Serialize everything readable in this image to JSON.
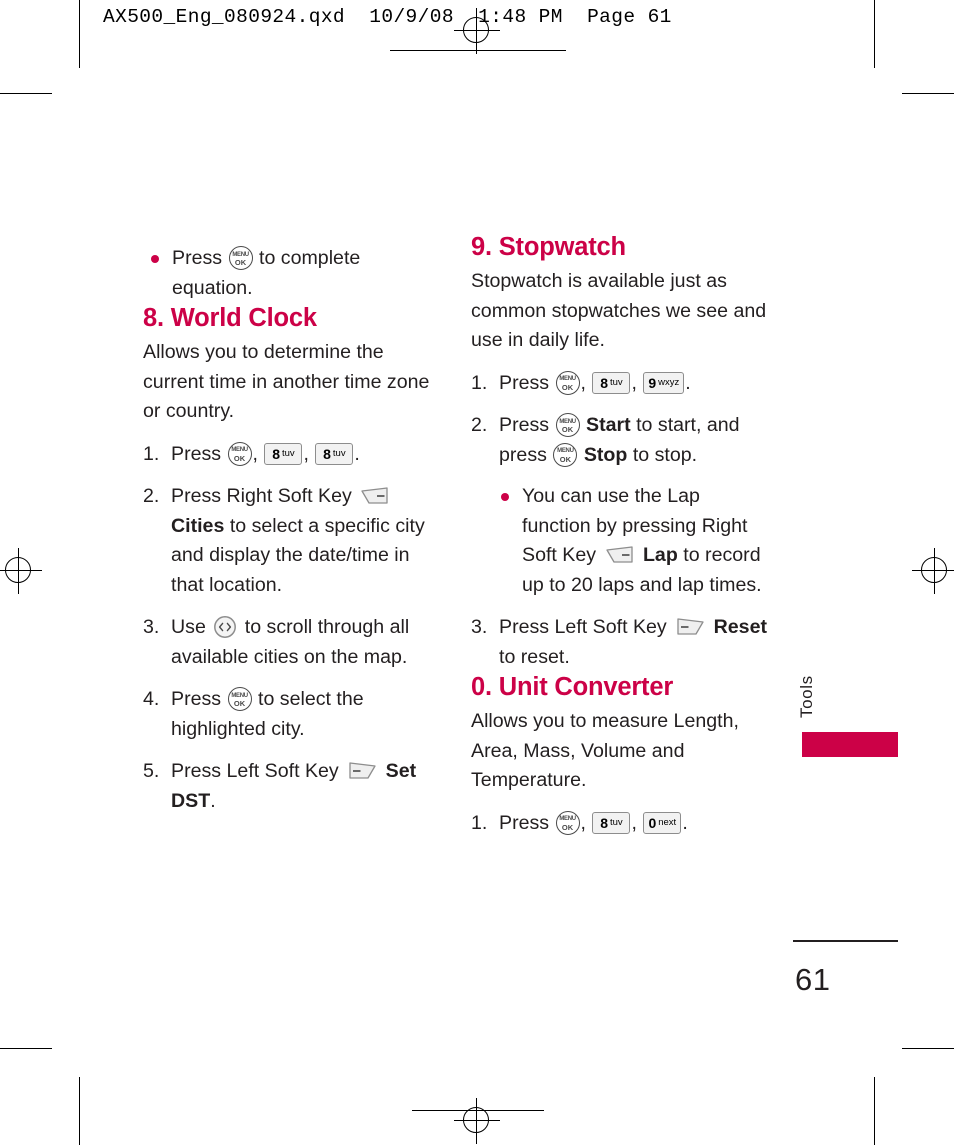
{
  "prepress": {
    "file_header": "AX500_Eng_080924.qxd  10/9/08  1:48 PM  Page 61"
  },
  "side_tab": {
    "label": "Tools"
  },
  "footer": {
    "page_number": "61"
  },
  "colors": {
    "accent": "#cc0147",
    "text": "#231f20",
    "key_border": "#8d8d8d",
    "key_fill": "#f2f2f2"
  },
  "keys": {
    "menu_ok": {
      "top": "MENU",
      "bottom": "OK"
    },
    "k8": {
      "digit": "8",
      "letters": "tuv"
    },
    "k9": {
      "digit": "9",
      "letters": "wxyz"
    },
    "k0": {
      "digit": "0",
      "letters": "next"
    }
  },
  "left_column": {
    "carryover_bullet": {
      "pre": "Press",
      "post": "to complete equation."
    },
    "section": {
      "heading": "8. World Clock",
      "intro": "Allows you to determine the current time in another time zone or country.",
      "steps": [
        {
          "num": "1.",
          "parts": [
            "Press",
            ",",
            ",",
            "."
          ]
        },
        {
          "num": "2.",
          "pre": "Press Right Soft Key",
          "bold": "Cities",
          "post": "to select a specific city and display the date/time in that location."
        },
        {
          "num": "3.",
          "pre": "Use",
          "post": "to scroll through all available cities on the map."
        },
        {
          "num": "4.",
          "pre": "Press",
          "post": "to select the highlighted city."
        },
        {
          "num": "5.",
          "pre": "Press Left Soft Key",
          "bold": "Set DST",
          "post": "."
        }
      ]
    }
  },
  "right_column": {
    "stopwatch": {
      "heading": "9. Stopwatch",
      "intro": "Stopwatch is available just as common stopwatches we see and use in daily life.",
      "step1": {
        "num": "1.",
        "pre": "Press"
      },
      "step2": {
        "num": "2.",
        "pre": "Press",
        "bold1": "Start",
        "mid": "to start, and press",
        "bold2": "Stop",
        "post": "to stop."
      },
      "bullet": {
        "pre": "You can use the Lap function by pressing Right Soft Key",
        "bold": "Lap",
        "post": "to record up to 20 laps and lap times."
      },
      "step3": {
        "num": "3.",
        "pre": "Press Left Soft Key",
        "bold": "Reset",
        "post": "to reset."
      }
    },
    "unit_converter": {
      "heading": "0. Unit Converter",
      "intro": "Allows you to measure Length, Area, Mass, Volume and Temperature.",
      "step1": {
        "num": "1.",
        "pre": "Press"
      }
    }
  }
}
